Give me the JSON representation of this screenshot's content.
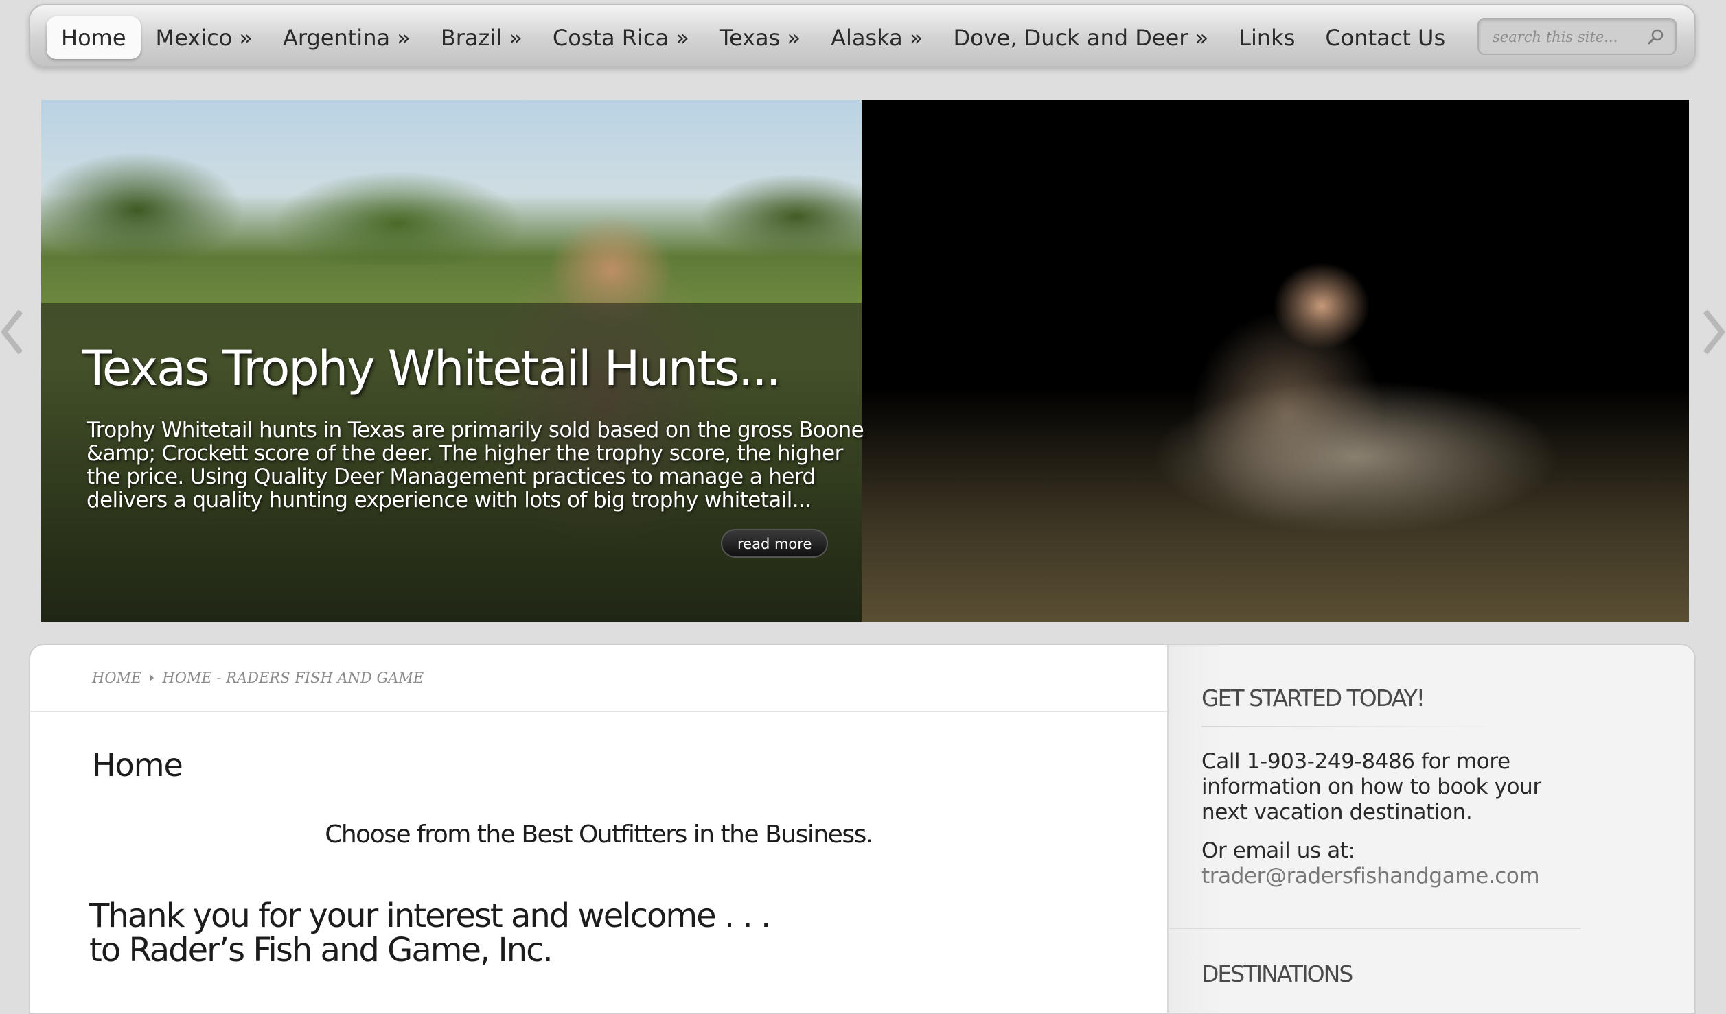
{
  "nav": {
    "items": [
      {
        "label": "Home"
      },
      {
        "label": "Mexico »"
      },
      {
        "label": "Argentina »"
      },
      {
        "label": "Brazil »"
      },
      {
        "label": "Costa Rica »"
      },
      {
        "label": "Texas »"
      },
      {
        "label": "Alaska »"
      },
      {
        "label": "Dove, Duck and Deer »"
      },
      {
        "label": "Links"
      },
      {
        "label": "Contact Us"
      }
    ],
    "active_index": 0,
    "search_placeholder": "search this site..."
  },
  "slider": {
    "title": "Texas Trophy Whitetail Hunts...",
    "description": "Trophy Whitetail hunts in Texas are primarily sold based on the gross Boone &amp; Crockett score of the deer. The higher the trophy score, the higher the price. Using Quality Deer Management practices to manage a herd delivers a quality hunting experience with lots of big trophy whitetail...",
    "read_more": "read more"
  },
  "breadcrumb": {
    "items": [
      "HOME",
      "HOME - RADERS FISH AND GAME"
    ]
  },
  "main": {
    "page_title": "Home",
    "tagline": "Choose from the Best Outfitters in the Business.",
    "welcome_line1": "Thank you for your interest and welcome . . .",
    "welcome_line2": "to Rader’s Fish and Game, Inc."
  },
  "sidebar": {
    "get_started_title": "GET STARTED TODAY!",
    "get_started_text": "Call 1-903-249-8486 for more information on how to book your next vacation destination.",
    "email_label": "Or email us at:",
    "email": "trader@radersfishandgame.com",
    "destinations_title": "DESTINATIONS"
  }
}
